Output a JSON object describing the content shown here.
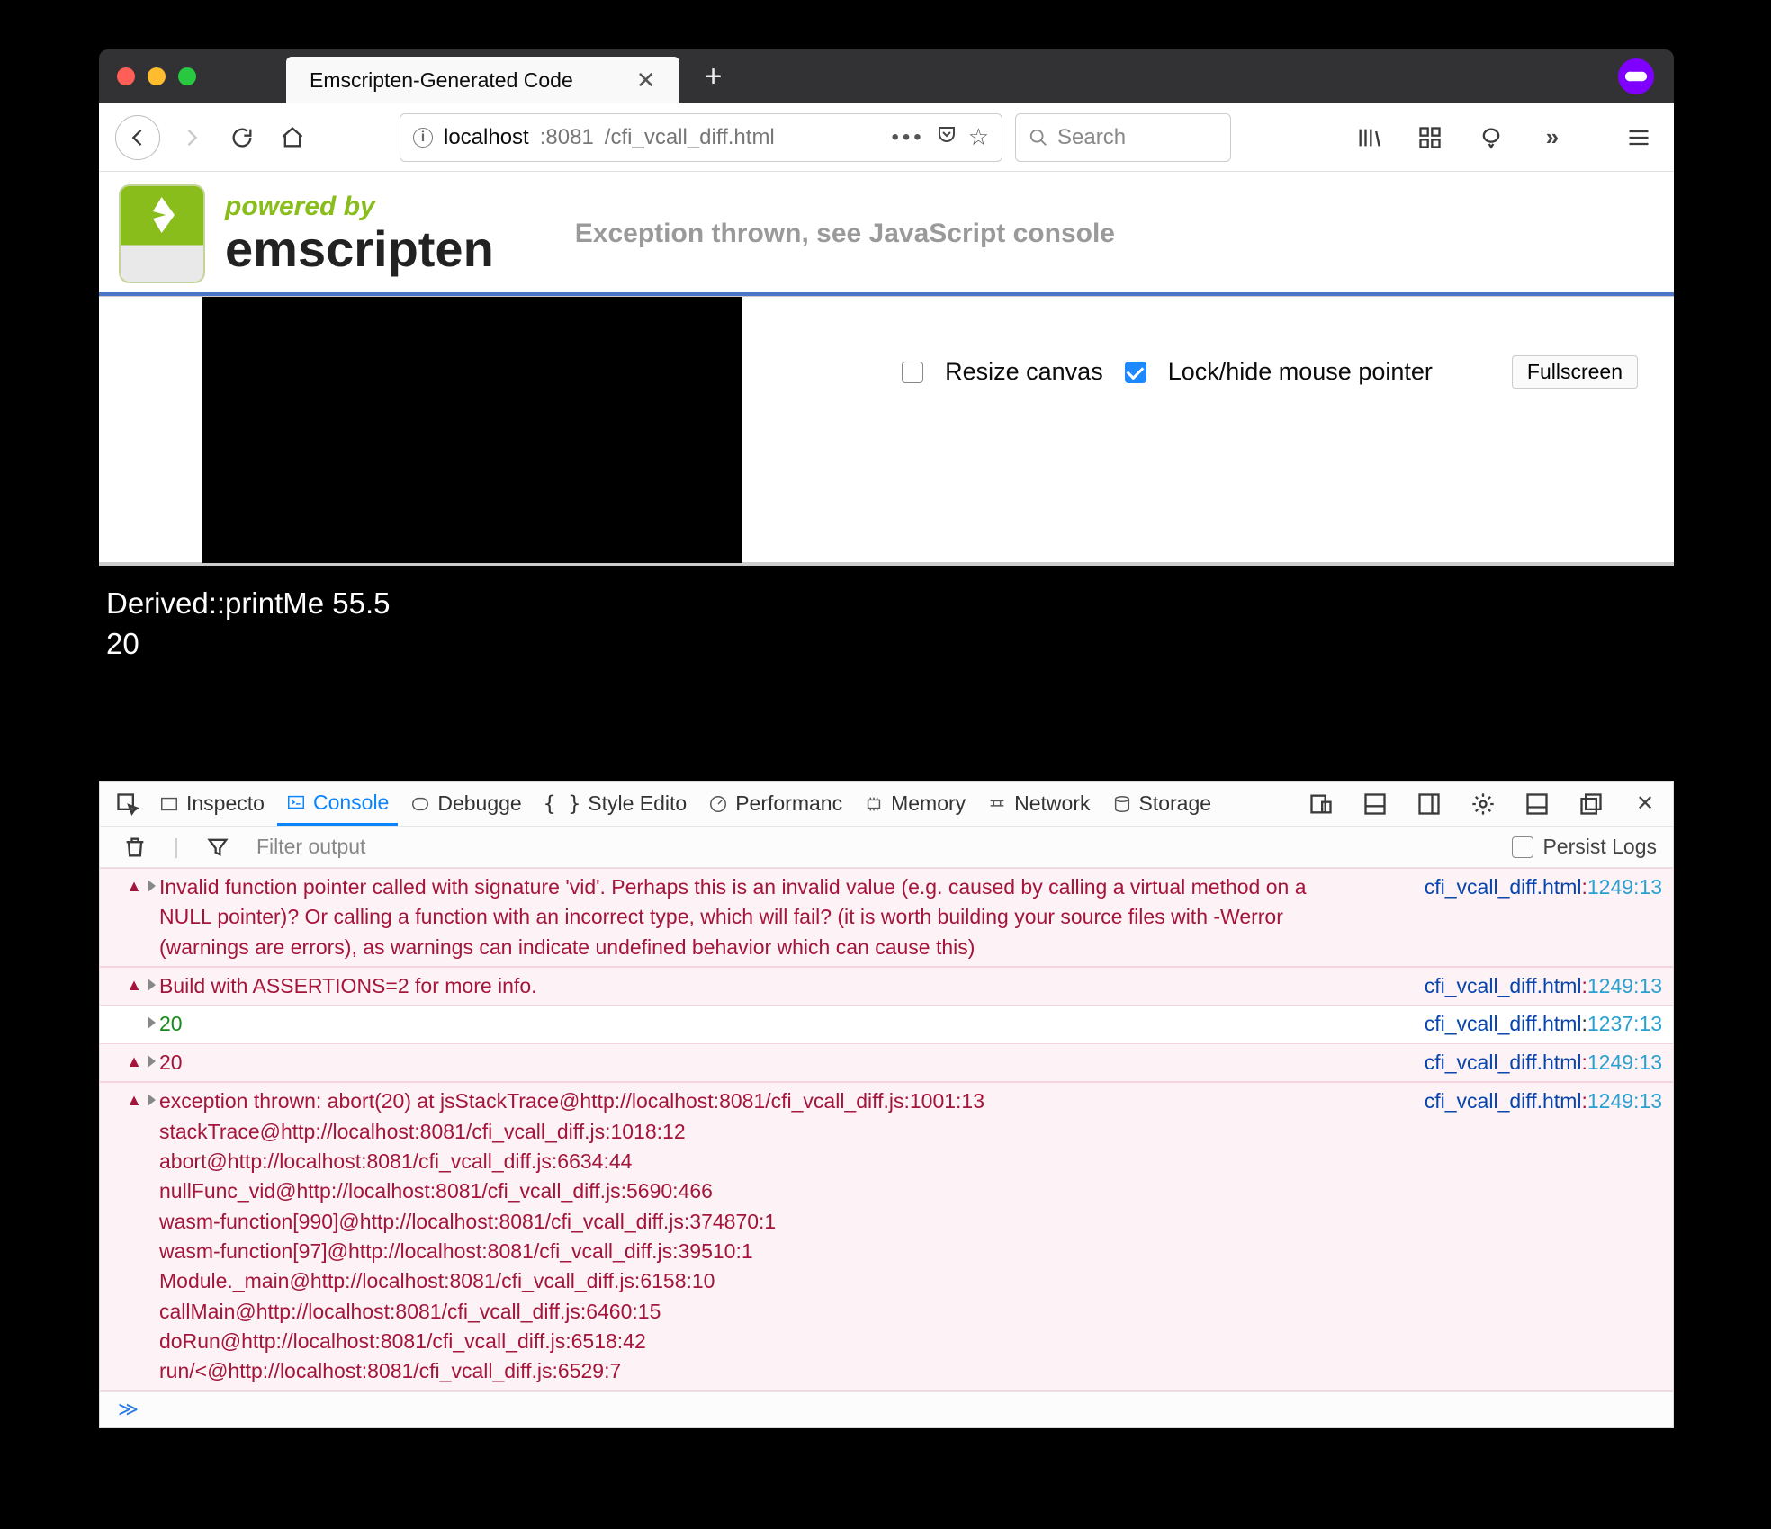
{
  "window": {
    "traffic": {
      "close": "#ff5f57",
      "min": "#febc2e",
      "max": "#28c840"
    },
    "tab_title": "Emscripten-Generated Code",
    "url_prefix": "localhost",
    "url_port": ":8081",
    "url_path": "/cfi_vcall_diff.html",
    "search_placeholder": "Search"
  },
  "page": {
    "logo_powered": "powered by",
    "logo_name": "emscripten",
    "status": "Exception thrown, see JavaScript console",
    "resize_label": "Resize canvas",
    "lock_label": "Lock/hide mouse pointer",
    "fullscreen": "Fullscreen",
    "resize_checked": false,
    "lock_checked": true
  },
  "terminal": {
    "line1": "Derived::printMe 55.5",
    "line2": "20"
  },
  "devtools": {
    "tabs": [
      "Inspecto",
      "Console",
      "Debugge",
      "Style Edito",
      "Performanc",
      "Memory",
      "Network",
      "Storage"
    ],
    "filter_placeholder": "Filter output",
    "persist": "Persist Logs",
    "rows": [
      {
        "type": "err",
        "msg": "Invalid function pointer called with signature 'vid'. Perhaps this is an invalid value (e.g. caused by calling a virtual method on a NULL pointer)? Or calling a function with an incorrect type, which will fail? (it is worth building your source files with -Werror (warnings are errors), as warnings can indicate undefined behavior which can cause this)",
        "file": "cfi_vcall_diff.html",
        "ln": "1249:13"
      },
      {
        "type": "err",
        "msg": "Build with ASSERTIONS=2 for more info.",
        "file": "cfi_vcall_diff.html",
        "ln": "1249:13"
      },
      {
        "type": "log",
        "msg": "20",
        "file": "cfi_vcall_diff.html",
        "ln": "1237:13"
      },
      {
        "type": "err",
        "msg": "20",
        "file": "cfi_vcall_diff.html",
        "ln": "1249:13"
      },
      {
        "type": "err",
        "msg": "exception thrown: abort(20) at jsStackTrace@http://localhost:8081/cfi_vcall_diff.js:1001:13\nstackTrace@http://localhost:8081/cfi_vcall_diff.js:1018:12\nabort@http://localhost:8081/cfi_vcall_diff.js:6634:44\nnullFunc_vid@http://localhost:8081/cfi_vcall_diff.js:5690:466\nwasm-function[990]@http://localhost:8081/cfi_vcall_diff.js:374870:1\nwasm-function[97]@http://localhost:8081/cfi_vcall_diff.js:39510:1\nModule._main@http://localhost:8081/cfi_vcall_diff.js:6158:10\ncallMain@http://localhost:8081/cfi_vcall_diff.js:6460:15\ndoRun@http://localhost:8081/cfi_vcall_diff.js:6518:42\nrun/<@http://localhost:8081/cfi_vcall_diff.js:6529:7",
        "file": "cfi_vcall_diff.html",
        "ln": "1249:13"
      }
    ]
  }
}
